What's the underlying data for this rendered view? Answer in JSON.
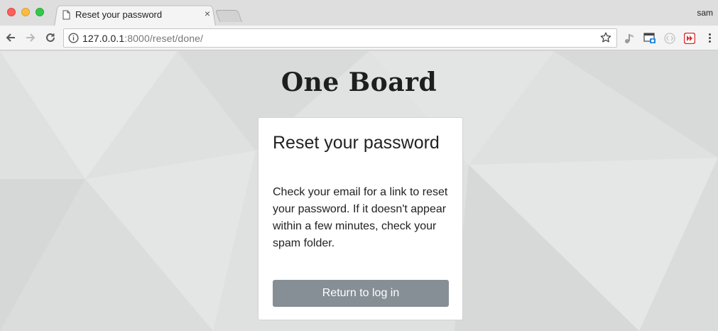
{
  "window": {
    "profile_name": "sam"
  },
  "tab": {
    "title": "Reset your password",
    "close_glyph": "×"
  },
  "toolbar": {
    "url_host": "127.0.0.1",
    "url_rest": ":8000/reset/done/"
  },
  "page": {
    "brand": "One Board",
    "card": {
      "title": "Reset your password",
      "message": "Check your email for a link to reset your password. If it doesn't appear within a few minutes, check your spam folder.",
      "button_label": "Return to log in"
    }
  },
  "colors": {
    "button": "#868e96",
    "background": "#dfe0e0",
    "card": "#ffffff"
  },
  "icons": [
    "back-arrow-icon",
    "forward-arrow-icon",
    "reload-icon",
    "info-icon",
    "star-icon",
    "page-icon",
    "close-icon",
    "menu-icon"
  ]
}
